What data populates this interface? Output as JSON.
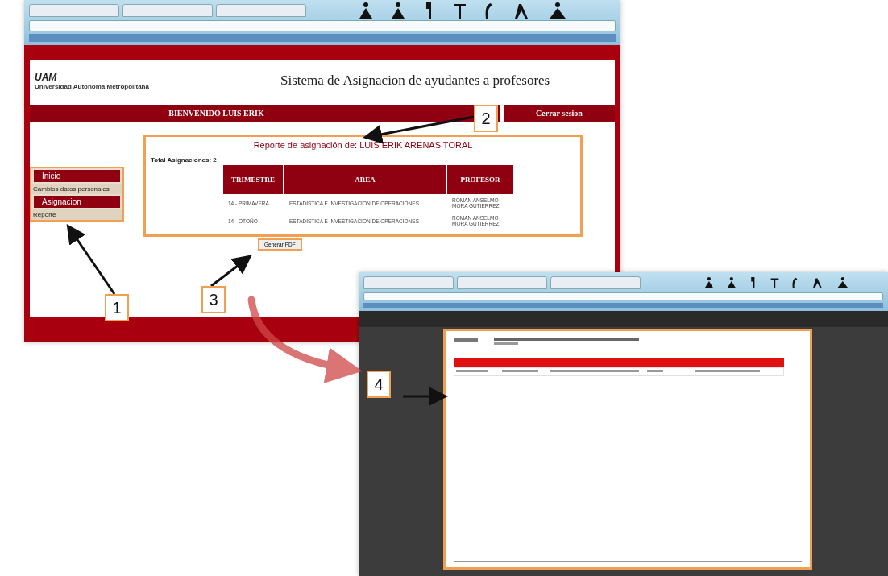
{
  "main_window": {
    "logo": {
      "abbr": "UAM",
      "name": "Universidad Autonoma Metropolitana"
    },
    "site_title": "Sistema de Asignacion de ayudantes a profesores",
    "welcome": "BIENVENIDO LUIS ERIK",
    "logout": "Cerrar sesion",
    "menu": [
      {
        "label": "Inicio",
        "kind": "header"
      },
      {
        "label": "Cambios datos personales",
        "kind": "link"
      },
      {
        "label": "Asignacion",
        "kind": "header"
      },
      {
        "label": "Reporte",
        "kind": "link"
      }
    ],
    "report": {
      "title": "Reporte de asignación de: LUIS ERIK ARENAS TORAL",
      "total": "Total Asignaciones: 2",
      "columns": [
        "TRIMESTRE",
        "AREA",
        "PROFESOR"
      ],
      "rows": [
        [
          "14 - PRIMAVERA",
          "ESTADISTICA E INVESTIGACION DE OPERACIONES",
          "ROMAN ANSELMO MORA GUTIERREZ"
        ],
        [
          "14 - OTOÑO",
          "ESTADISTICA E INVESTIGACION DE OPERACIONES",
          "ROMAN ANSELMO MORA GUTIERREZ"
        ]
      ]
    },
    "pdf_button": "Generar PDF"
  },
  "callouts": [
    {
      "label": "1"
    },
    {
      "label": "2"
    },
    {
      "label": "3"
    },
    {
      "label": "4"
    }
  ]
}
